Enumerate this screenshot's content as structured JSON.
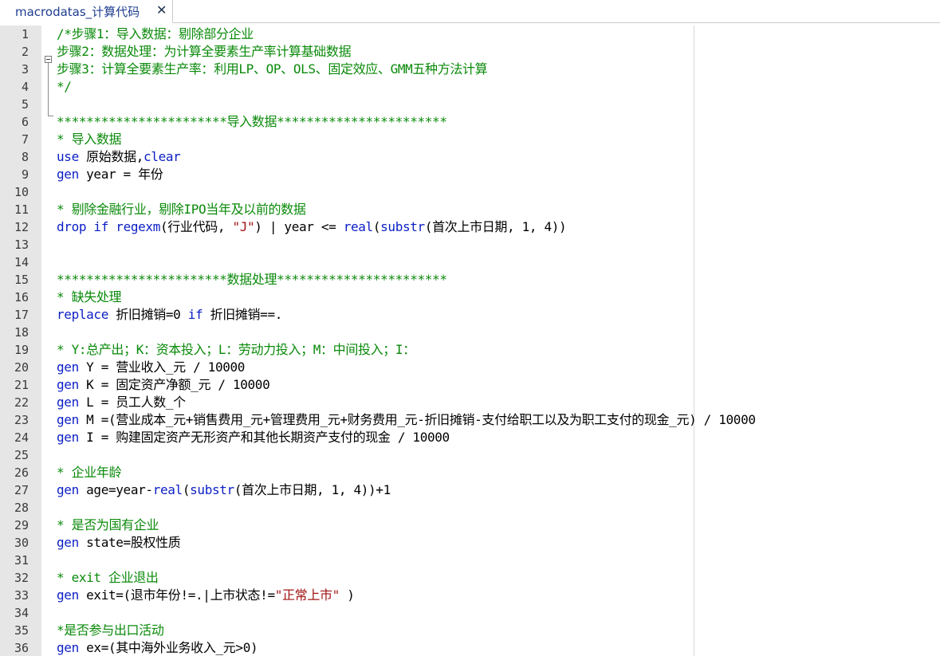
{
  "tab": {
    "title": "macrodatas_计算代码",
    "close_glyph": "✕"
  },
  "colors": {
    "comment": "#0a8a0a",
    "keyword": "#0b1ec4",
    "string": "#a01414",
    "gutter_bg": "#e6e6e6",
    "tab_text": "#1e3d8f"
  },
  "editor": {
    "lines": [
      {
        "n": "1",
        "tokens": [
          {
            "t": "/*步骤1：导入数据：剔除部分企业",
            "c": "comment"
          }
        ]
      },
      {
        "n": "2",
        "tokens": [
          {
            "t": "步骤2：数据处理：为计算全要素生产率计算基础数据",
            "c": "comment"
          }
        ]
      },
      {
        "n": "3",
        "tokens": [
          {
            "t": "步骤3：计算全要素生产率：利用LP、OP、OLS、固定效应、GMM五种方法计算",
            "c": "comment"
          }
        ]
      },
      {
        "n": "4",
        "tokens": [
          {
            "t": "*/",
            "c": "comment"
          }
        ]
      },
      {
        "n": "5",
        "tokens": []
      },
      {
        "n": "6",
        "tokens": [
          {
            "t": "***********************导入数据***********************",
            "c": "comment"
          }
        ]
      },
      {
        "n": "7",
        "tokens": [
          {
            "t": "* 导入数据",
            "c": "comment"
          }
        ]
      },
      {
        "n": "8",
        "tokens": [
          {
            "t": "use",
            "c": "keyword"
          },
          {
            "t": " 原始数据,",
            "c": "plain"
          },
          {
            "t": "clear",
            "c": "keyword"
          }
        ]
      },
      {
        "n": "9",
        "tokens": [
          {
            "t": "gen",
            "c": "keyword"
          },
          {
            "t": " year = 年份",
            "c": "plain"
          }
        ]
      },
      {
        "n": "10",
        "tokens": []
      },
      {
        "n": "11",
        "tokens": [
          {
            "t": "* 剔除金融行业，剔除IPO当年及以前的数据",
            "c": "comment"
          }
        ]
      },
      {
        "n": "12",
        "tokens": [
          {
            "t": "drop if",
            "c": "keyword"
          },
          {
            "t": " ",
            "c": "plain"
          },
          {
            "t": "regexm",
            "c": "func"
          },
          {
            "t": "(行业代码, ",
            "c": "plain"
          },
          {
            "t": "\"J\"",
            "c": "string"
          },
          {
            "t": ") | year <= ",
            "c": "plain"
          },
          {
            "t": "real",
            "c": "func"
          },
          {
            "t": "(",
            "c": "plain"
          },
          {
            "t": "substr",
            "c": "func"
          },
          {
            "t": "(首次上市日期, 1, 4))",
            "c": "plain"
          }
        ]
      },
      {
        "n": "13",
        "tokens": []
      },
      {
        "n": "14",
        "tokens": []
      },
      {
        "n": "15",
        "tokens": [
          {
            "t": "***********************数据处理***********************",
            "c": "comment"
          }
        ]
      },
      {
        "n": "16",
        "tokens": [
          {
            "t": "* 缺失处理",
            "c": "comment"
          }
        ]
      },
      {
        "n": "17",
        "tokens": [
          {
            "t": "replace",
            "c": "keyword"
          },
          {
            "t": " 折旧摊销=0 ",
            "c": "plain"
          },
          {
            "t": "if",
            "c": "keyword"
          },
          {
            "t": " 折旧摊销==.",
            "c": "plain"
          }
        ]
      },
      {
        "n": "18",
        "tokens": []
      },
      {
        "n": "19",
        "tokens": [
          {
            "t": "* Y:总产出；K：资本投入；L：劳动力投入；M：中间投入；I：",
            "c": "comment"
          }
        ]
      },
      {
        "n": "20",
        "tokens": [
          {
            "t": "gen",
            "c": "keyword"
          },
          {
            "t": " Y = 营业收入_元 / 10000",
            "c": "plain"
          }
        ]
      },
      {
        "n": "21",
        "tokens": [
          {
            "t": "gen",
            "c": "keyword"
          },
          {
            "t": " K = 固定资产净额_元 / 10000",
            "c": "plain"
          }
        ]
      },
      {
        "n": "22",
        "tokens": [
          {
            "t": "gen",
            "c": "keyword"
          },
          {
            "t": " L = 员工人数_个",
            "c": "plain"
          }
        ]
      },
      {
        "n": "23",
        "tokens": [
          {
            "t": "gen",
            "c": "keyword"
          },
          {
            "t": " M =(营业成本_元+销售费用_元+管理费用_元+财务费用_元-折旧摊销-支付给职工以及为职工支付的现金_元) / 10000",
            "c": "plain"
          }
        ]
      },
      {
        "n": "24",
        "tokens": [
          {
            "t": "gen",
            "c": "keyword"
          },
          {
            "t": " I = 购建固定资产无形资产和其他长期资产支付的现金 / 10000",
            "c": "plain"
          }
        ]
      },
      {
        "n": "25",
        "tokens": []
      },
      {
        "n": "26",
        "tokens": [
          {
            "t": "* 企业年龄",
            "c": "comment"
          }
        ]
      },
      {
        "n": "27",
        "tokens": [
          {
            "t": "gen",
            "c": "keyword"
          },
          {
            "t": " age=year-",
            "c": "plain"
          },
          {
            "t": "real",
            "c": "func"
          },
          {
            "t": "(",
            "c": "plain"
          },
          {
            "t": "substr",
            "c": "func"
          },
          {
            "t": "(首次上市日期, 1, 4))+1",
            "c": "plain"
          }
        ]
      },
      {
        "n": "28",
        "tokens": []
      },
      {
        "n": "29",
        "tokens": [
          {
            "t": "* 是否为国有企业",
            "c": "comment"
          }
        ]
      },
      {
        "n": "30",
        "tokens": [
          {
            "t": "gen",
            "c": "keyword"
          },
          {
            "t": " state=股权性质",
            "c": "plain"
          }
        ]
      },
      {
        "n": "31",
        "tokens": []
      },
      {
        "n": "32",
        "tokens": [
          {
            "t": "* exit 企业退出",
            "c": "comment"
          }
        ]
      },
      {
        "n": "33",
        "tokens": [
          {
            "t": "gen",
            "c": "keyword"
          },
          {
            "t": " exit=(退市年份!=.|上市状态!=",
            "c": "plain"
          },
          {
            "t": "\"正常上市\"",
            "c": "string"
          },
          {
            "t": " )",
            "c": "plain"
          }
        ]
      },
      {
        "n": "34",
        "tokens": []
      },
      {
        "n": "35",
        "tokens": [
          {
            "t": "*是否参与出口活动",
            "c": "comment"
          }
        ]
      },
      {
        "n": "36",
        "tokens": [
          {
            "t": "gen",
            "c": "keyword"
          },
          {
            "t": " ex=(其中海外业务收入_元>0)",
            "c": "plain"
          }
        ]
      }
    ]
  }
}
